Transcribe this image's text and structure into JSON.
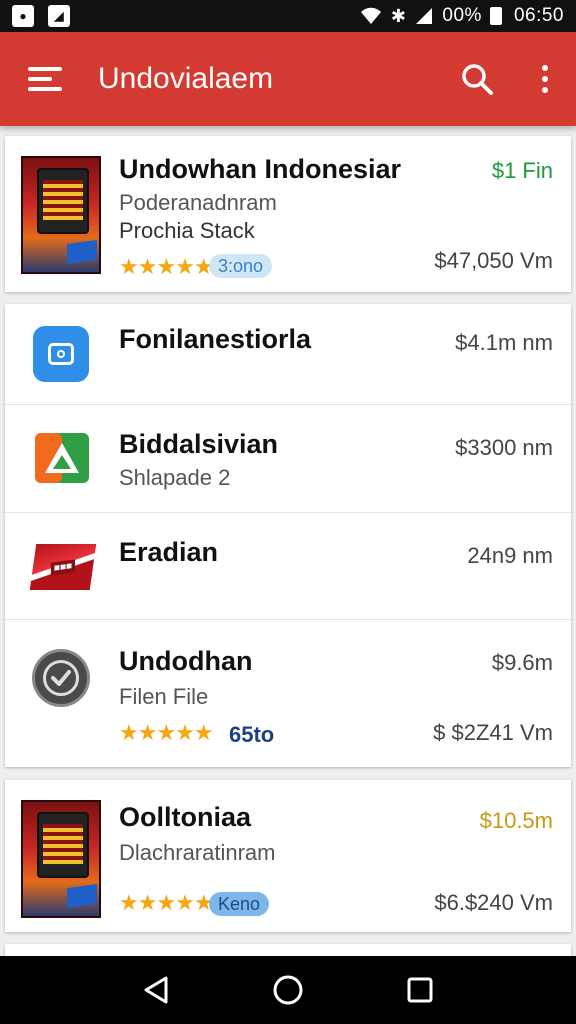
{
  "status_bar": {
    "battery_text": "00%",
    "time": "06:50"
  },
  "app_bar": {
    "title": "Undovialaem"
  },
  "items": [
    {
      "title": "Undowhan Indonesiar",
      "subtitle": "Poderanadnram",
      "detail": "Prochia Stack",
      "price_top": "$1 Fin",
      "price_bottom": "$47,050 Vm",
      "rating_stars": "★★★★★",
      "rating": 4.5,
      "badge": "3:ono",
      "icon": "app-cover-icon"
    },
    {
      "title": "Fonilanestiorla",
      "price_top": "$4.1m nm",
      "icon": "camera-icon"
    },
    {
      "title": "Biddalsivian",
      "subtitle": "Shlapade 2",
      "price_top": "$3300 nm",
      "icon": "play-store-icon"
    },
    {
      "title": "Eradian",
      "price_top": "24n9 nm",
      "icon": "flag-badge-icon"
    },
    {
      "title": "Undodhan",
      "subtitle": "Filen File",
      "price_top": "$9.6m",
      "price_bottom": "$ $2Z41 Vm",
      "rating_stars": "★★★★★",
      "rating": 5,
      "count": "65to",
      "icon": "check-circle-icon"
    },
    {
      "title": "Oolltoniaa",
      "subtitle": "Dlachraratinram",
      "price_top": "$10.5m",
      "price_bottom": "$6.$240 Vm",
      "rating_stars": "★★★★★",
      "rating": 4.5,
      "badge": "Keno",
      "icon": "app-cover-icon"
    }
  ],
  "colors": {
    "app_bar": "#d23a32",
    "price_green": "#1f9a3a",
    "price_gold": "#c49a10",
    "star": "#f4a712"
  }
}
